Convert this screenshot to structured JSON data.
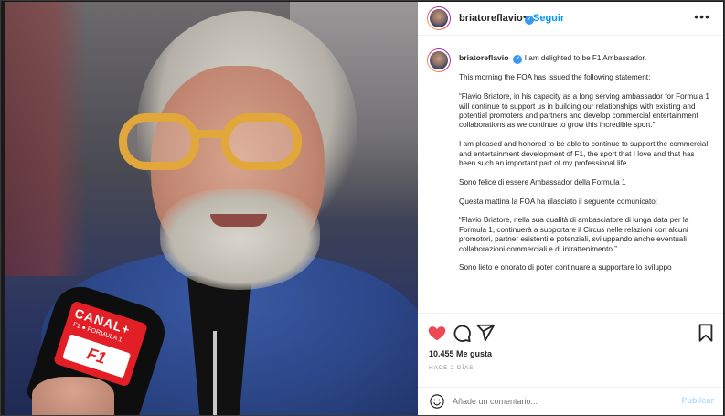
{
  "header": {
    "username": "briatoreflavio",
    "verified": true,
    "separator": "•",
    "follow_label": "Seguir",
    "more_icon": "more-horizontal-icon"
  },
  "caption": {
    "username": "briatoreflavio",
    "paragraphs": [
      "I am delighted to be F1 Ambassador.",
      "This morning the FOA has issued the following statement:",
      "“Flavio Briatore, in his capacity as a long serving ambassador for Formula 1 will continue to support us in building our relationships with existing and potential promoters and partners and develop commercial entertainment collaborations as we continue to grow this incredible sport.”",
      "I am pleased and honored to be able to continue to support the commercial and entertainment development of F1, the sport that I love and that has been such an important part of my professional life.",
      "Sono felice di essere Ambassador della Formula 1",
      "Questa mattina la FOA ha rilasciato il seguente comunicato:",
      "“Flavio Briatore, nella sua qualità di ambasciatore di lunga data per la Formula 1, continuerà a supportare il Circus nelle relazioni con alcuni promotori, partner esistenti e potenziali, sviluppando anche eventuali collaborazioni commerciali e di intrattenimento.”",
      "Sono lieto e onorato di poter continuare a supportare lo sviluppo"
    ]
  },
  "photo": {
    "mic_brand": "CANAL+",
    "mic_sub": "F1 ● FORMULA 1",
    "mic_logo": "F1"
  },
  "actions": {
    "like_icon": "heart-filled-icon",
    "comment_icon": "comment-icon",
    "share_icon": "send-icon",
    "save_icon": "bookmark-icon",
    "like_color": "#ed4956",
    "likes_text": "10.455 Me gusta",
    "time_ago": "HACE 2 DÍAS"
  },
  "comment": {
    "emoji_icon": "emoji-icon",
    "placeholder": "Añade un comentario...",
    "post_label": "Publicar"
  }
}
